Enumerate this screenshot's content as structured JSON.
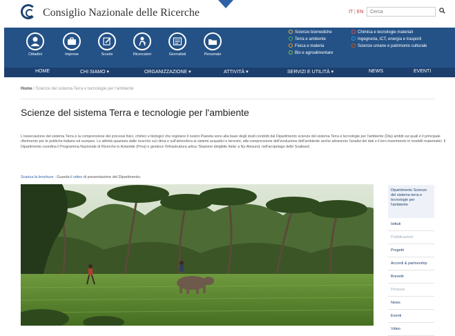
{
  "header": {
    "site_title": "Consiglio Nazionale delle Ricerche",
    "lang_it": "IT",
    "lang_sep": " | ",
    "lang_en": "EN",
    "search_placeholder": "Cerca",
    "search_icon": "magnifier-icon"
  },
  "audiences": [
    {
      "label": "Cittadini",
      "icon": "citizen-icon"
    },
    {
      "label": "Imprese",
      "icon": "briefcase-icon"
    },
    {
      "label": "Scuole",
      "icon": "pencil-icon"
    },
    {
      "label": "Ricercatori",
      "icon": "researcher-icon"
    },
    {
      "label": "Giornalisti",
      "icon": "newspaper-icon"
    },
    {
      "label": "Personale",
      "icon": "folder-icon"
    }
  ],
  "areas_left": [
    {
      "label": "Scienze biomediche",
      "color": "#f0c040"
    },
    {
      "label": "Terra e ambiente",
      "color": "#4caf50"
    },
    {
      "label": "Fisica e materia",
      "color": "#f39c12"
    },
    {
      "label": "Bio e agroalimentare",
      "color": "#8bc34a"
    }
  ],
  "areas_right": [
    {
      "label": "Chimica e tecnologie materiali",
      "color": "#e74c3c"
    },
    {
      "label": "Ingegneria, ICT, energia e trasporti",
      "color": "#3498db"
    },
    {
      "label": "Scienze umane e patrimonio culturale",
      "color": "#d35400"
    }
  ],
  "menu": [
    "HOME",
    "CHI SIAMO ▾",
    "ORGANIZZAZIONE ▾",
    "ATTIVITÀ ▾",
    "SERVIZI E UTILITÀ ▾",
    "NEWS",
    "EVENTI"
  ],
  "breadcrumb": {
    "home": "Home",
    "sep": " / ",
    "current": "Scienze del sistema Terra e tecnologie per l'ambiente"
  },
  "page_title": "Scienze del sistema Terra e tecnologie per l'ambiente",
  "intro": "L'osservazione del sistema Terra e la comprensione dei processi fisici, chimici e biologici che regolano il nostro Pianeta sono alla base degli studi condotti dal Dipartimento scienze del sistema Terra e tecnologie per l'ambiente (Dta) ambiti sui quali è il principale riferimento per le politiche italiane ed europee. Le attività spaziano dalle ricerche sul clima e sull'atmosfera ai sistemi acquatici e terrestri, alla comprensione dell'evoluzione dell'ambiente anche attraverso l'analisi dei dati e il loro inserimento in modelli matematici. Il Dipartimento coordina il Programma Nazionale di Ricerche in Antartide (Pnra) e gestisce l'infrastruttura artica 'Stazione dirigibile Italia' a Ny-Alesund, nell'arcipelago delle Svalbard.",
  "links": {
    "brochure": "Scarica la brochure",
    "sep1": " - Guarda ",
    "video": "il video",
    "after": " di presentazione del Dipartimento."
  },
  "sidebar": {
    "header": "Dipartimento Scienze del sistema terra e tecnologie per l'ambiente",
    "items": [
      {
        "label": "Istituti"
      },
      {
        "label": "Pubblicazioni"
      },
      {
        "label": "Progetti"
      },
      {
        "label": "Accordi & partnership"
      },
      {
        "label": "Brevetti"
      },
      {
        "label": "Persone"
      },
      {
        "label": "News"
      },
      {
        "label": "Eventi"
      },
      {
        "label": "Video"
      }
    ]
  }
}
